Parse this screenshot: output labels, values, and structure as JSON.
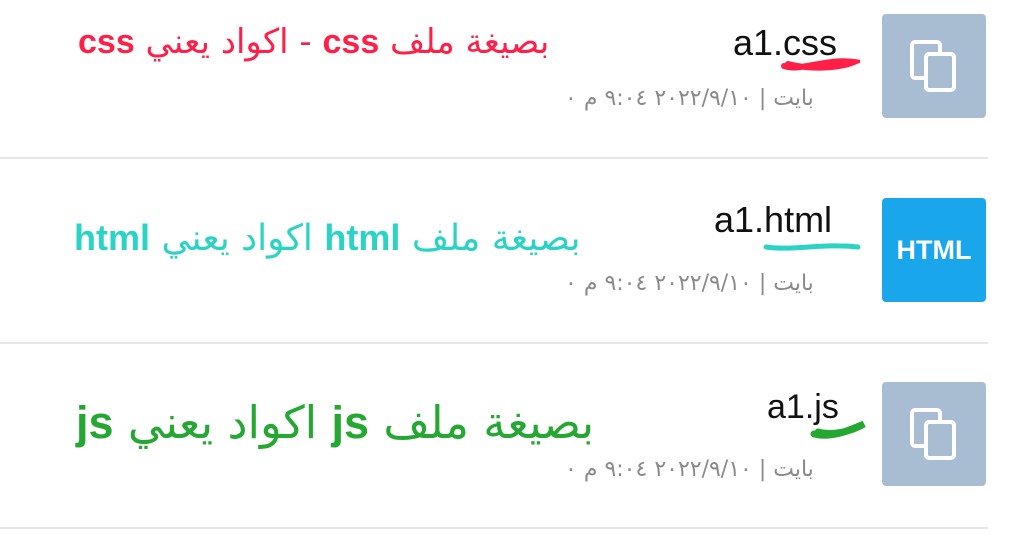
{
  "files": [
    {
      "name": "a1.css",
      "meta": "۰ بايت | ۲۰۲۲/۹/۱۰ ۹:۰٤ م",
      "icon": "document-icon",
      "annotation": {
        "prefix_code": "css",
        "text1": " اكواد يعني - ",
        "code": "css",
        "text2": " بصيغة ملف",
        "color": "#ff1f47"
      }
    },
    {
      "name": "a1.html",
      "meta": "۰ بايت | ۲۰۲۲/۹/۱۰ ۹:۰٤ م",
      "icon": "html-icon",
      "icon_label": "HTML",
      "annotation": {
        "prefix_code": "html",
        "text1": " اكواد يعني ",
        "code": "html",
        "text2": " بصيغة ملف",
        "color": "#2bd3c5"
      }
    },
    {
      "name": "a1.js",
      "meta": "۰ بايت | ۲۰۲۲/۹/۱۰ ۹:۰٤ م",
      "icon": "document-icon",
      "annotation": {
        "prefix_code": "js",
        "text1": " اكواد يعني ",
        "code": "js",
        "text2": " بصيغة ملف",
        "color": "#24a832"
      }
    }
  ]
}
